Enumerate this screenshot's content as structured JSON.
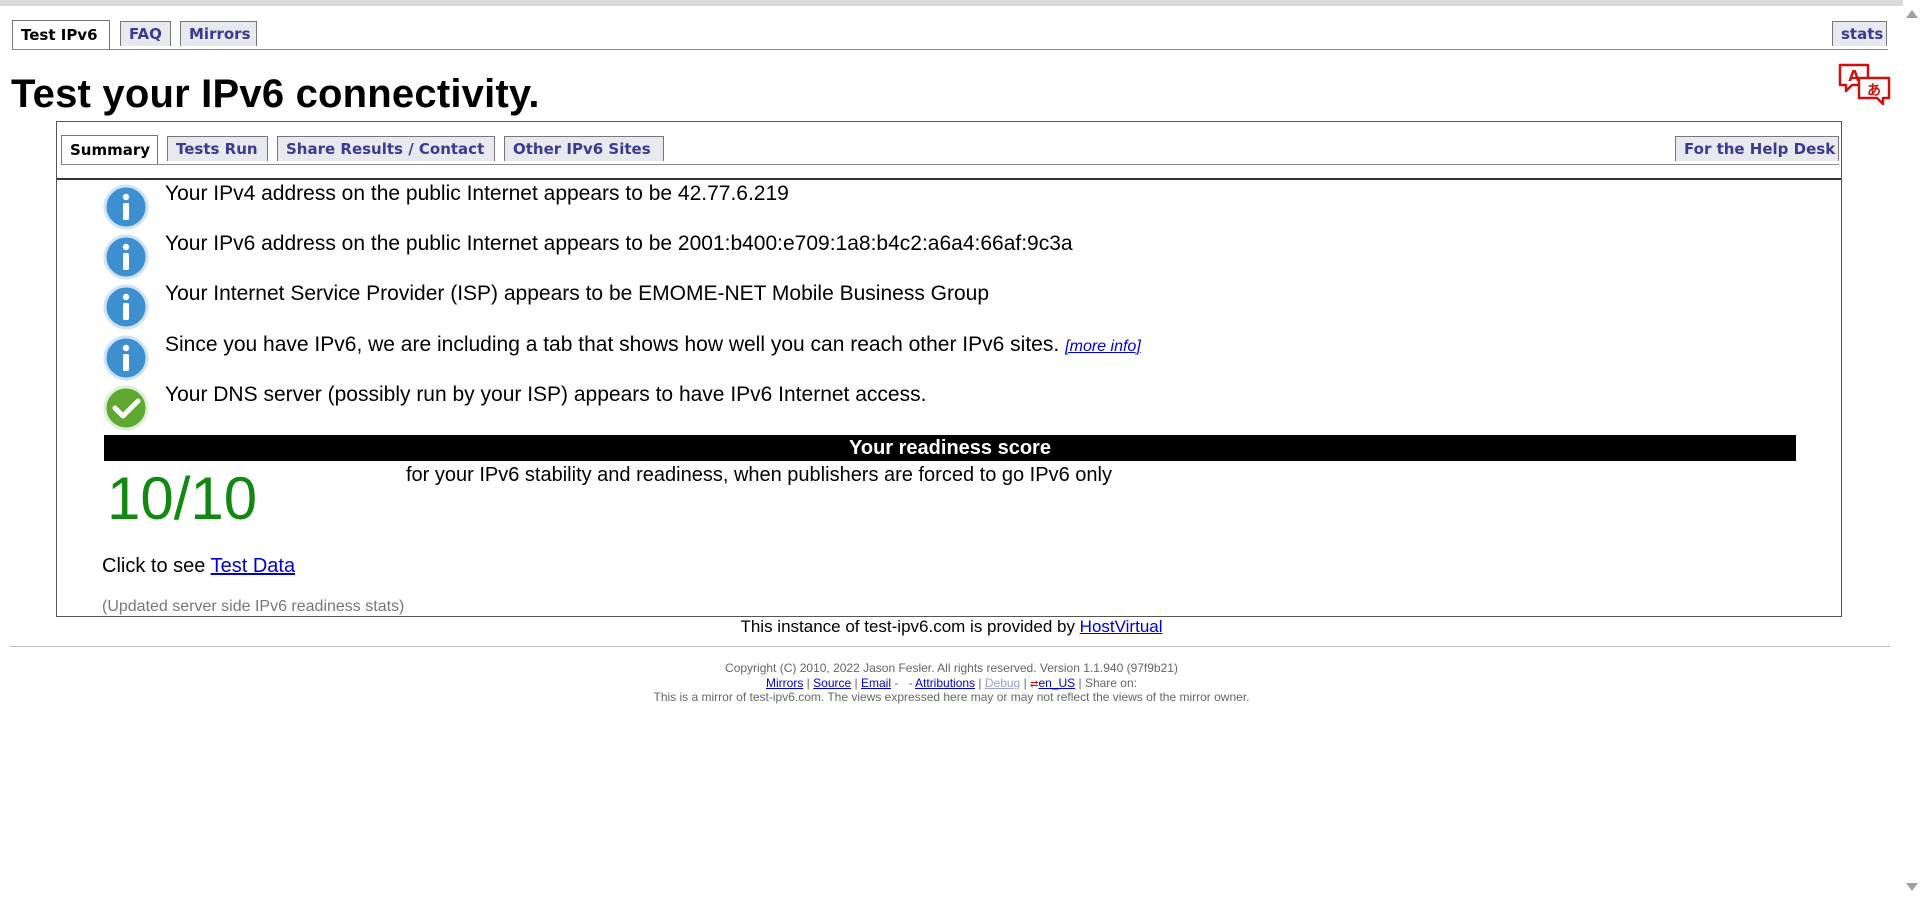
{
  "top_tabs": {
    "test_ipv6": "Test IPv6",
    "faq": "FAQ",
    "mirrors": "Mirrors",
    "stats": "stats"
  },
  "page_title": "Test your IPv6 connectivity.",
  "sub_tabs": {
    "summary": "Summary",
    "tests_run": "Tests Run",
    "share": "Share Results / Contact",
    "other_sites": "Other IPv6 Sites",
    "help_desk": "For the Help Desk"
  },
  "results": [
    {
      "icon": "info-icon",
      "text": "Your IPv4 address on the public Internet appears to be 42.77.6.219"
    },
    {
      "icon": "info-icon",
      "text": "Your IPv6 address on the public Internet appears to be 2001:b400:e709:1a8:b4c2:a6a4:66af:9c3a"
    },
    {
      "icon": "info-icon",
      "text": "Your Internet Service Provider (ISP) appears to be EMOME-NET Mobile Business Group"
    },
    {
      "icon": "info-icon",
      "text": "Since you have IPv6, we are including a tab that shows how well you can reach other IPv6 sites.",
      "link": "[more info]"
    },
    {
      "icon": "check-icon",
      "text": "Your DNS server (possibly run by your ISP) appears to have IPv6 Internet access."
    }
  ],
  "readiness": {
    "header": "Your readiness score",
    "score": "10/10",
    "description": "for your IPv6 stability and readiness, when publishers are forced to go IPv6 only"
  },
  "test_data": {
    "prefix": "Click to see ",
    "link": "Test Data"
  },
  "updated_stats": "(Updated server side IPv6 readiness stats)",
  "instance": {
    "text": "This instance of test-ipv6.com is provided by ",
    "link": "HostVirtual"
  },
  "footer": {
    "copyright": "Copyright (C) 2010, 2022 Jason Fesler. All rights reserved. Version 1.1.940 (97f9b21)",
    "mirrors": "Mirrors",
    "source": "Source",
    "email": "Email",
    "attributions": "Attributions",
    "debug": "Debug",
    "locale": "en_US",
    "share_on": "Share on:",
    "mirror_note": "This is a mirror of test-ipv6.com. The views expressed here may or may not reflect the views of the mirror owner."
  },
  "colors": {
    "tab_text": "#3b3b8e",
    "tab_bg": "#e8e8ef",
    "score_green": "#118811",
    "info_blue": "#3d8fd0",
    "check_green": "#5fa832",
    "link": "#0000cc"
  }
}
